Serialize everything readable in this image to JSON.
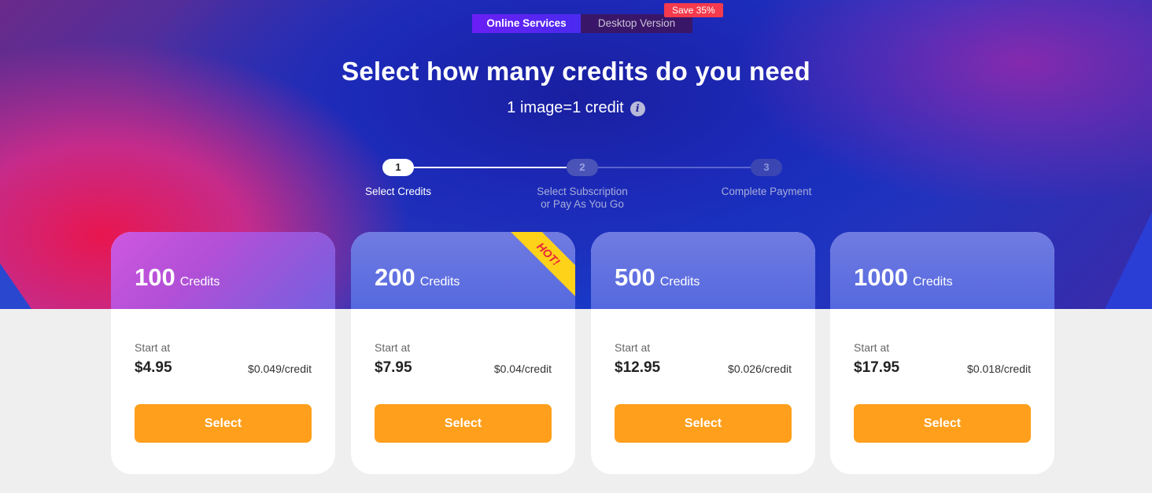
{
  "mode_toggle": {
    "online_label": "Online Services",
    "desktop_label": "Desktop Version",
    "save_badge": "Save 35%"
  },
  "header": {
    "title": "Select how many credits do you need",
    "subtitle": "1 image=1 credit",
    "info_icon": "info-icon"
  },
  "stepper": {
    "steps": [
      {
        "number": "1",
        "label_line1": "Select Credits",
        "label_line2": "",
        "state": "active"
      },
      {
        "number": "2",
        "label_line1": "Select Subscription",
        "label_line2": "or Pay As You Go",
        "state": "inactive"
      },
      {
        "number": "3",
        "label_line1": "Complete Payment",
        "label_line2": "",
        "state": "inactive"
      }
    ]
  },
  "cards": [
    {
      "amount": "100",
      "unit": "Credits",
      "start_label": "Start at",
      "price": "$4.95",
      "per_credit": "$0.049/credit",
      "button": "Select"
    },
    {
      "amount": "200",
      "unit": "Credits",
      "start_label": "Start at",
      "price": "$7.95",
      "per_credit": "$0.04/credit",
      "button": "Select",
      "ribbon": "HOT!"
    },
    {
      "amount": "500",
      "unit": "Credits",
      "start_label": "Start at",
      "price": "$12.95",
      "per_credit": "$0.026/credit",
      "button": "Select"
    },
    {
      "amount": "1000",
      "unit": "Credits",
      "start_label": "Start at",
      "price": "$17.95",
      "per_credit": "$0.018/credit",
      "button": "Select"
    }
  ],
  "colors": {
    "accent_button": "#ff9f1c",
    "save_badge": "#f43a4c",
    "hot_ribbon": "#ffd21a"
  }
}
